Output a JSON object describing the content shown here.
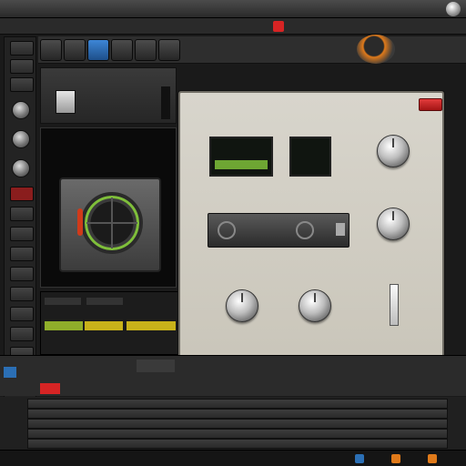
{
  "menubar": {
    "items": [
      "",
      "",
      "",
      "",
      ""
    ],
    "title": ""
  },
  "dialog": {
    "title": "",
    "screen_left_text": "",
    "labels": [
      "",
      "",
      "",
      "",
      ""
    ],
    "ok_label": "",
    "brand": ""
  },
  "colors": {
    "accent_red": "#d62424",
    "screen_green": "#7fbf3a",
    "meter_yellow": "#c8b21a",
    "orange_glow": "#e07a1a",
    "blue_button": "#2b6fb5"
  },
  "icons": [
    "gear-icon",
    "record-icon",
    "transport-icon",
    "knob-icon"
  ]
}
